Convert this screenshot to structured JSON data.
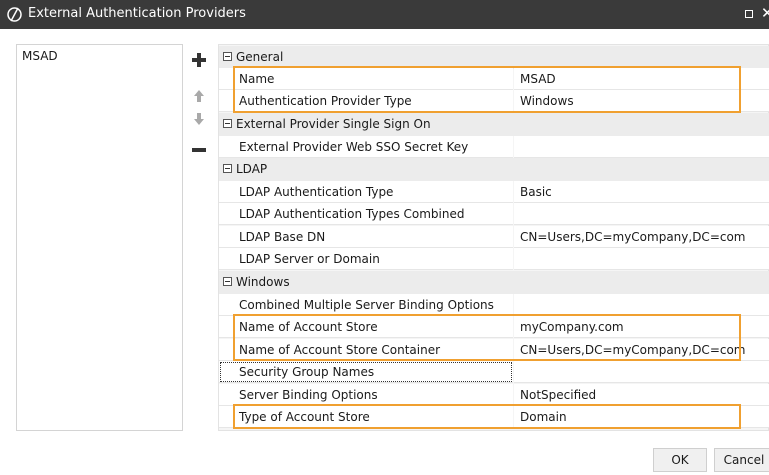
{
  "window": {
    "title": "External Authentication Providers",
    "close_glyph": "✕",
    "icons": {
      "logo": "slashed-circle-logo",
      "maximize": "maximize-icon",
      "close": "close-icon"
    }
  },
  "providers": {
    "items": [
      "MSAD"
    ]
  },
  "toolbar": {
    "icons": {
      "add": "plus-icon",
      "up": "arrow-up-icon",
      "down": "arrow-down-icon",
      "remove": "minus-icon"
    }
  },
  "property_grid": {
    "categories": [
      {
        "label": "General",
        "properties": [
          {
            "name": "Name",
            "value": "MSAD"
          },
          {
            "name": "Authentication Provider Type",
            "value": "Windows"
          }
        ]
      },
      {
        "label": "External Provider Single Sign On",
        "properties": [
          {
            "name": "External Provider Web SSO Secret Key",
            "value": ""
          }
        ]
      },
      {
        "label": "LDAP",
        "properties": [
          {
            "name": "LDAP Authentication Type",
            "value": "Basic"
          },
          {
            "name": "LDAP Authentication Types Combined",
            "value": ""
          },
          {
            "name": "LDAP Base DN",
            "value": "CN=Users,DC=myCompany,DC=com"
          },
          {
            "name": "LDAP Server or Domain",
            "value": ""
          }
        ]
      },
      {
        "label": "Windows",
        "properties": [
          {
            "name": "Combined Multiple Server Binding Options",
            "value": ""
          },
          {
            "name": "Name of Account Store",
            "value": "myCompany.com"
          },
          {
            "name": "Name of Account Store Container",
            "value": "CN=Users,DC=myCompany,DC=com"
          },
          {
            "name": "Security Group Names",
            "value": ""
          },
          {
            "name": "Server Binding Options",
            "value": "NotSpecified"
          },
          {
            "name": "Type of Account Store",
            "value": "Domain"
          }
        ]
      }
    ]
  },
  "highlight_color": "#f0a030",
  "footer": {
    "ok_label": "OK",
    "cancel_label": "Cancel"
  }
}
